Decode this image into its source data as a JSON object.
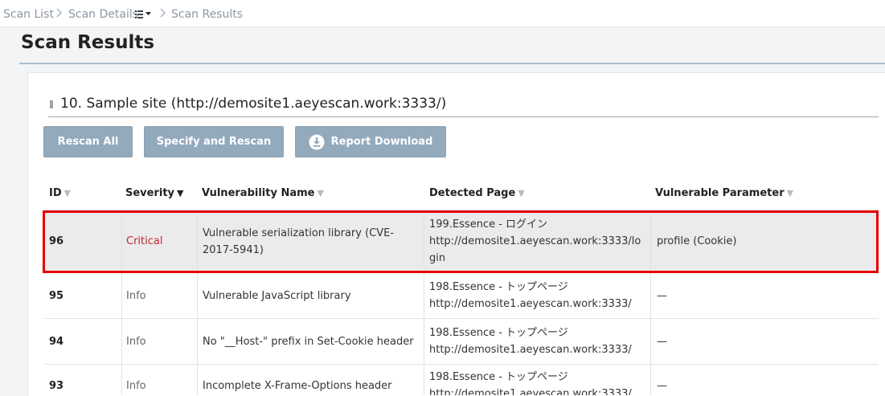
{
  "breadcrumb": {
    "items": [
      "Scan List",
      "Scan Details",
      "Scan Results"
    ],
    "menu_icon": "list-menu-icon"
  },
  "page_title": "Scan Results",
  "site": {
    "title": "10. Sample site (http://demosite1.aeyescan.work:3333/)"
  },
  "buttons": {
    "rescan_all": "Rescan All",
    "specify_rescan": "Specify and Rescan",
    "report_download": "Report Download",
    "download_icon": "download-icon"
  },
  "table": {
    "headers": {
      "id": "ID",
      "severity": "Severity",
      "name": "Vulnerability Name",
      "page": "Detected Page",
      "param": "Vulnerable Parameter"
    },
    "sort_icon": "▼",
    "rows": [
      {
        "id": "96",
        "severity": "Critical",
        "name": "Vulnerable serialization library (CVE-2017-5941)",
        "page_title": "199.Essence - ログイン",
        "page_url": "http://demosite1.aeyescan.work:3333/login",
        "param": "profile (Cookie)"
      },
      {
        "id": "95",
        "severity": "Info",
        "name": "Vulnerable JavaScript library",
        "page_title": "198.Essence - トップページ",
        "page_url": "http://demosite1.aeyescan.work:3333/",
        "param": "—"
      },
      {
        "id": "94",
        "severity": "Info",
        "name": "No \"__Host-\" prefix in Set-Cookie header",
        "page_title": "198.Essence - トップページ",
        "page_url": "http://demosite1.aeyescan.work:3333/",
        "param": "—"
      },
      {
        "id": "93",
        "severity": "Info",
        "name": "Incomplete X-Frame-Options header",
        "page_title": "198.Essence - トップページ",
        "page_url": "http://demosite1.aeyescan.work:3333/",
        "param": "—"
      }
    ]
  },
  "colors": {
    "button": "#93a9bc",
    "critical": "#c0262d",
    "highlight_border": "#e60000"
  }
}
